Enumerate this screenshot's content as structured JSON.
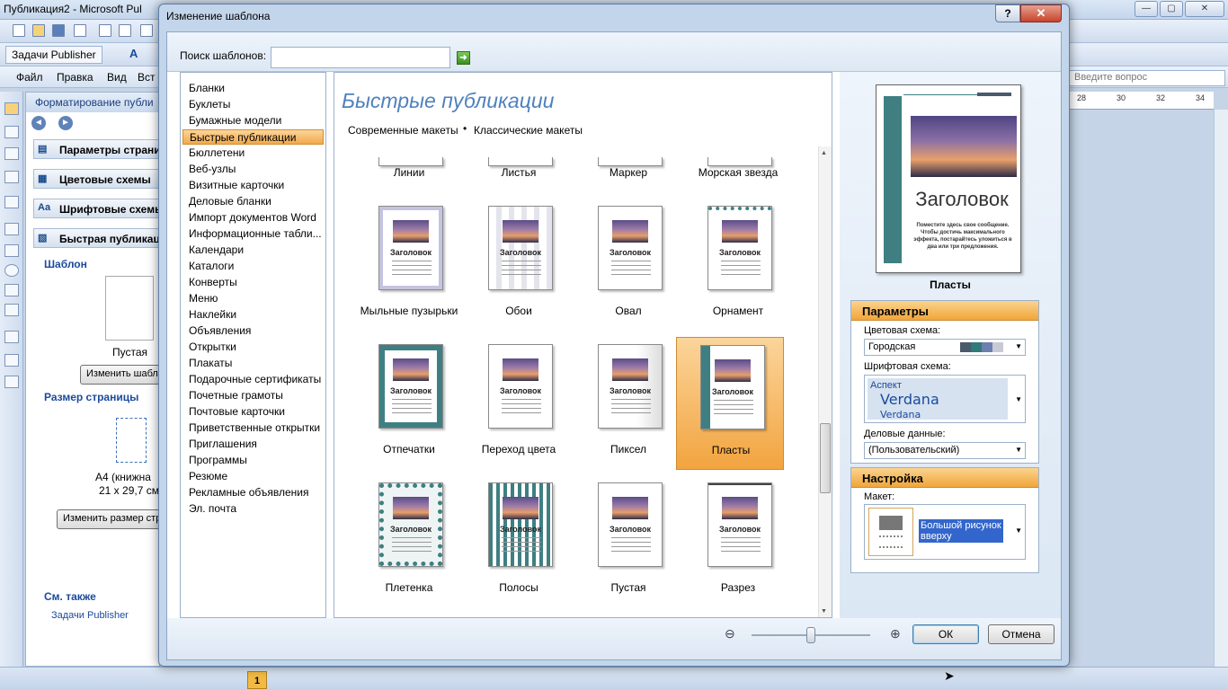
{
  "app": {
    "title": "Публикация2 - Microsoft Pul",
    "min": "—",
    "max": "▢",
    "close": "✕",
    "toolbar_task": "Задачи Publisher",
    "menu": [
      "Файл",
      "Правка",
      "Вид",
      "Вст"
    ],
    "help_placeholder": "Введите вопрос",
    "ruler_ticks": [
      "28",
      "30",
      "32",
      "34"
    ],
    "page_number": "1"
  },
  "taskpane": {
    "title": "Форматирование публи",
    "sections": [
      "Параметры страни",
      "Цветовые схемы",
      "Шрифтовые схемы",
      "Быстрая публикаци"
    ],
    "template_heading": "Шаблон",
    "template_name": "Пустая",
    "change_template_btn": "Изменить шабло",
    "page_size_heading": "Размер страницы",
    "page_size_name": "A4 (книжна",
    "page_size_dims": "21 x 29,7 см",
    "change_size_btn": "Изменить размер стр",
    "see_also": "См. также",
    "link_tasks": "Задачи Publisher"
  },
  "dialog": {
    "title": "Изменение шаблона",
    "help": "?",
    "close": "✕",
    "search_label": "Поиск шаблонов:",
    "search_value": "",
    "search_go": "➜",
    "categories": [
      "Бланки",
      "Буклеты",
      "Бумажные модели",
      "Быстрые публикации",
      "Бюллетени",
      "Веб-узлы",
      "Визитные карточки",
      "Деловые бланки",
      "Импорт документов Word",
      "Информационные табли...",
      "Календари",
      "Каталоги",
      "Конверты",
      "Меню",
      "Наклейки",
      "Объявления",
      "Открытки",
      "Плакаты",
      "Подарочные сертификаты",
      "Почетные грамоты",
      "Почтовые карточки",
      "Приветственные открытки",
      "Приглашения",
      "Программы",
      "Резюме",
      "Рекламные объявления",
      "Эл. почта"
    ],
    "selected_category": 3,
    "gallery_title": "Быстрые публикации",
    "filter_modern": "Современные макеты",
    "filter_sep": "•",
    "filter_classic": "Классические макеты",
    "thumb_heading": "Заголовок",
    "top_row": [
      "Линии",
      "Листья",
      "Маркер",
      "Морская звезда"
    ],
    "row1": [
      "Мыльные пузырьки",
      "Обои",
      "Овал",
      "Орнамент"
    ],
    "row2": [
      "Отпечатки",
      "Переход цвета",
      "Пиксел",
      "Пласты"
    ],
    "row3": [
      "Плетенка",
      "Полосы",
      "Пустая",
      "Разрез"
    ],
    "selected_tile": "Пласты",
    "preview": {
      "heading": "Заголовок",
      "body": "Поместите здесь свое сообщение. Чтобы достичь максимального эффекта, постарайтесь уложиться в два или три предложения.",
      "name": "Пласты"
    },
    "params": {
      "title": "Параметры",
      "color_label": "Цветовая схема:",
      "color_value": "Городская",
      "color_swatches": [
        "#4a5a6a",
        "#2f7a7a",
        "#6d7fae",
        "#c9c9d6"
      ],
      "font_label": "Шрифтовая схема:",
      "font_scheme_name": "Аспект",
      "font_major": "Verdana",
      "font_minor": "Verdana",
      "business_label": "Деловые данные:",
      "business_value": "(Пользовательский)"
    },
    "setup": {
      "title": "Настройка",
      "layout_label": "Макет:",
      "layout_value": "Большой рисунок вверху"
    },
    "ok": "ОК",
    "cancel": "Отмена",
    "zoom_out": "⊖",
    "zoom_in": "⊕",
    "zoom_level": 0.5
  },
  "colors": {
    "accent_orange": "#f0a63a",
    "selection_blue": "#3366cc",
    "title_blue": "#4f81bd",
    "teal": "#3f7f82"
  }
}
